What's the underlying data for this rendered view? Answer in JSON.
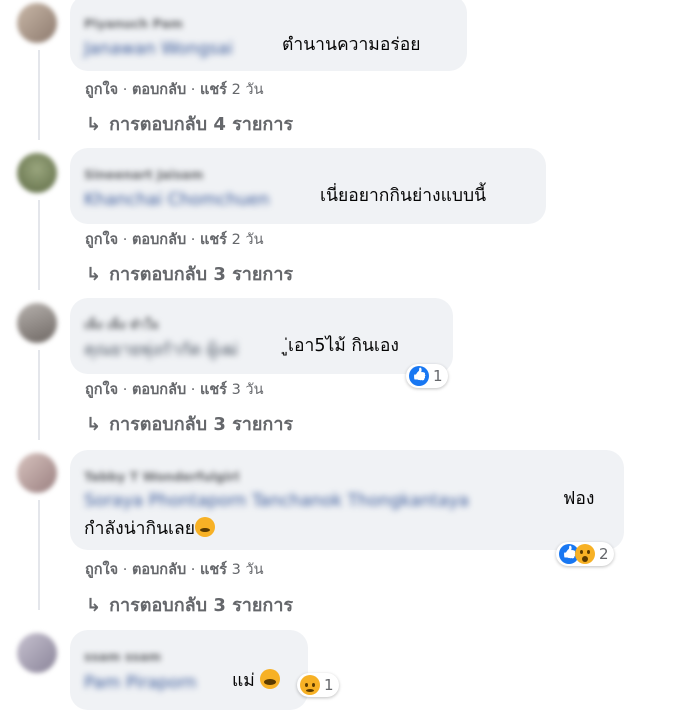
{
  "comments": [
    {
      "author": "Piyanuch Pam",
      "tagged": "Janawan Wongsai",
      "text": "ตำนานความอร่อย",
      "actions": {
        "like": "ถูกใจ",
        "reply": "ตอบกลับ",
        "share": "แชร์",
        "time": "2 วัน"
      },
      "replies": "การตอบกลับ 4 รายการ"
    },
    {
      "author": "Sineenart Jaisam",
      "tagged": "Khanchai Chomchuen",
      "text": "เนี่ยอยากกินย่างแบบนี้",
      "actions": {
        "like": "ถูกใจ",
        "reply": "ตอบกลับ",
        "share": "แชร์",
        "time": "2 วัน"
      },
      "replies": "การตอบกลับ 3 รายการ"
    },
    {
      "author": "เพ็ง เพ็ง ทำใจ",
      "tagged": "คุณยายพุ่งกำกัด ผู้เฒ่",
      "text": "ู่เอา5ไม้ กินเอง",
      "reaction_count": "1",
      "actions": {
        "like": "ถูกใจ",
        "reply": "ตอบกลับ",
        "share": "แชร์",
        "time": "3 วัน"
      },
      "replies": "การตอบกลับ 3 รายการ"
    },
    {
      "author": "Tabby T Wonderfulgirl",
      "tagged": "Soraya Phontaporn Tanchanok Thongkantaya",
      "text_line1": "ฟอง",
      "text_line2": "กำลังน่ากินเลย",
      "reaction_count": "2",
      "actions": {
        "like": "ถูกใจ",
        "reply": "ตอบกลับ",
        "share": "แชร์",
        "time": "3 วัน"
      },
      "replies": "การตอบกลับ 3 รายการ"
    },
    {
      "author": "ssam ssam",
      "tagged": "Pam Piraporn",
      "text": "แม่",
      "reaction_count": "1"
    }
  ],
  "colors": {
    "bubble": "#f0f2f5",
    "meta": "#65676b",
    "like": "#1877f2",
    "emoji": "#f7b125"
  }
}
